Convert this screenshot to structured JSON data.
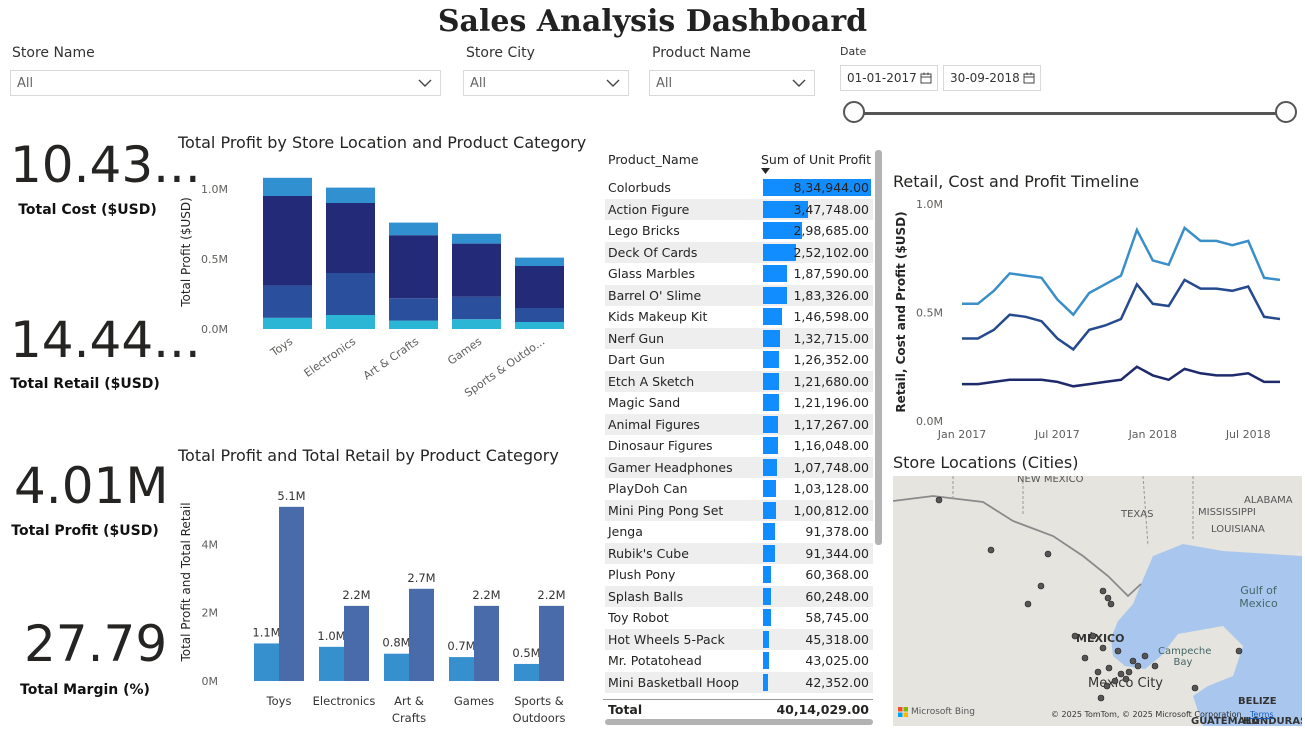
{
  "header": {
    "title": "Sales Analysis Dashboard"
  },
  "slicers": {
    "store_name": {
      "label": "Store Name",
      "value": "All"
    },
    "store_city": {
      "label": "Store City",
      "value": "All"
    },
    "product_name": {
      "label": "Product Name",
      "value": "All"
    },
    "date": {
      "label": "Date",
      "start": "01-01-2017",
      "end": "30-09-2018"
    }
  },
  "kpis": [
    {
      "value": "10.43...",
      "label": "Total Cost ($USD)"
    },
    {
      "value": "14.44...",
      "label": "Total Retail ($USD)"
    },
    {
      "value": "4.01M",
      "label": "Total Profit ($USD)"
    },
    {
      "value": "27.79",
      "label": "Total Margin (%)"
    }
  ],
  "chart_data": [
    {
      "id": "stacked",
      "type": "bar",
      "title": "Total Profit by Store Location and Product Category",
      "xlabel": "",
      "ylabel": "Total Profit ($USD)",
      "ylim": [
        0,
        1.1
      ],
      "y_ticks": [
        "0.0M",
        "0.5M",
        "1.0M"
      ],
      "categories": [
        "Toys",
        "Electronics",
        "Art & Crafts",
        "Games",
        "Sports & Outdo..."
      ],
      "series": [
        {
          "color": "#2bb6d6",
          "values": [
            0.08,
            0.1,
            0.06,
            0.07,
            0.05
          ]
        },
        {
          "color": "#2a4f9c",
          "values": [
            0.23,
            0.3,
            0.16,
            0.16,
            0.1
          ]
        },
        {
          "color": "#232a78",
          "values": [
            0.64,
            0.5,
            0.45,
            0.38,
            0.3
          ]
        },
        {
          "color": "#3190cf",
          "values": [
            0.13,
            0.11,
            0.09,
            0.07,
            0.06
          ]
        }
      ]
    },
    {
      "id": "clustered",
      "type": "bar",
      "title": "Total Profit and Total Retail by Product Category",
      "xlabel": "",
      "ylabel": "Total Profit and Total Retail",
      "ylim": [
        0,
        5.3
      ],
      "y_ticks": [
        "0M",
        "2M",
        "4M"
      ],
      "categories": [
        "Toys",
        "Electronics",
        "Art & Crafts",
        "Games",
        "Sports & Outdoors"
      ],
      "category_lines": [
        [
          "Toys"
        ],
        [
          "Electronics"
        ],
        [
          "Art &",
          "Crafts"
        ],
        [
          "Games"
        ],
        [
          "Sports &",
          "Outdoors"
        ]
      ],
      "series": [
        {
          "color": "#3590cd",
          "values": [
            1.1,
            1.0,
            0.8,
            0.7,
            0.5
          ],
          "labels": [
            "1.1M",
            "1.0M",
            "0.8M",
            "0.7M",
            "0.5M"
          ]
        },
        {
          "color": "#4a6baa",
          "values": [
            5.1,
            2.2,
            2.7,
            2.2,
            2.2
          ],
          "labels": [
            "5.1M",
            "2.2M",
            "2.7M",
            "2.2M",
            "2.2M"
          ]
        }
      ]
    },
    {
      "id": "timeline",
      "type": "line",
      "title": "Retail, Cost and Profit Timeline",
      "xlabel": "",
      "ylabel": "Retail, Cost and Profit ($USD)",
      "ylim": [
        0,
        1.0
      ],
      "y_ticks": [
        "0.0M",
        "0.5M",
        "1.0M"
      ],
      "x_ticks": [
        "Jan 2017",
        "Jul 2017",
        "Jan 2018",
        "Jul 2018"
      ],
      "x": [
        "2017-01",
        "2017-02",
        "2017-03",
        "2017-04",
        "2017-05",
        "2017-06",
        "2017-07",
        "2017-08",
        "2017-09",
        "2017-10",
        "2017-11",
        "2017-12",
        "2018-01",
        "2018-02",
        "2018-03",
        "2018-04",
        "2018-05",
        "2018-06",
        "2018-07",
        "2018-08",
        "2018-09"
      ],
      "series": [
        {
          "color": "#3b8fc9",
          "values": [
            0.54,
            0.54,
            0.6,
            0.68,
            0.67,
            0.66,
            0.56,
            0.49,
            0.59,
            0.63,
            0.67,
            0.88,
            0.74,
            0.72,
            0.89,
            0.83,
            0.83,
            0.81,
            0.83,
            0.66,
            0.65
          ]
        },
        {
          "color": "#264a8e",
          "values": [
            0.38,
            0.38,
            0.42,
            0.49,
            0.48,
            0.46,
            0.38,
            0.33,
            0.42,
            0.44,
            0.47,
            0.63,
            0.54,
            0.53,
            0.65,
            0.61,
            0.61,
            0.6,
            0.62,
            0.48,
            0.47
          ]
        },
        {
          "color": "#1e2a6b",
          "values": [
            0.17,
            0.17,
            0.18,
            0.19,
            0.19,
            0.19,
            0.18,
            0.16,
            0.17,
            0.18,
            0.19,
            0.25,
            0.21,
            0.19,
            0.24,
            0.22,
            0.21,
            0.21,
            0.22,
            0.18,
            0.18
          ]
        }
      ]
    },
    {
      "id": "product_table",
      "type": "table",
      "columns": [
        "Product_Name",
        "Sum of Unit Profit"
      ],
      "max_value": 834944,
      "rows": [
        {
          "name": "Colorbuds",
          "display": "8,34,944.00",
          "value": 834944
        },
        {
          "name": "Action Figure",
          "display": "3,47,748.00",
          "value": 347748
        },
        {
          "name": "Lego Bricks",
          "display": "2,98,685.00",
          "value": 298685
        },
        {
          "name": "Deck Of Cards",
          "display": "2,52,102.00",
          "value": 252102
        },
        {
          "name": "Glass Marbles",
          "display": "1,87,590.00",
          "value": 187590
        },
        {
          "name": "Barrel O' Slime",
          "display": "1,83,326.00",
          "value": 183326
        },
        {
          "name": "Kids Makeup Kit",
          "display": "1,46,598.00",
          "value": 146598
        },
        {
          "name": "Nerf Gun",
          "display": "1,32,715.00",
          "value": 132715
        },
        {
          "name": "Dart Gun",
          "display": "1,26,352.00",
          "value": 126352
        },
        {
          "name": "Etch A Sketch",
          "display": "1,21,680.00",
          "value": 121680
        },
        {
          "name": "Magic Sand",
          "display": "1,21,196.00",
          "value": 121196
        },
        {
          "name": "Animal Figures",
          "display": "1,17,267.00",
          "value": 117267
        },
        {
          "name": "Dinosaur Figures",
          "display": "1,16,048.00",
          "value": 116048
        },
        {
          "name": "Gamer Headphones",
          "display": "1,07,748.00",
          "value": 107748
        },
        {
          "name": "PlayDoh Can",
          "display": "1,03,128.00",
          "value": 103128
        },
        {
          "name": "Mini Ping Pong Set",
          "display": "1,00,812.00",
          "value": 100812
        },
        {
          "name": "Jenga",
          "display": "91,378.00",
          "value": 91378
        },
        {
          "name": "Rubik's Cube",
          "display": "91,344.00",
          "value": 91344
        },
        {
          "name": "Plush Pony",
          "display": "60,368.00",
          "value": 60368
        },
        {
          "name": "Splash Balls",
          "display": "60,248.00",
          "value": 60248
        },
        {
          "name": "Toy Robot",
          "display": "58,745.00",
          "value": 58745
        },
        {
          "name": "Hot Wheels 5-Pack",
          "display": "45,318.00",
          "value": 45318
        },
        {
          "name": "Mr. Potatohead",
          "display": "43,025.00",
          "value": 43025
        },
        {
          "name": "Mini Basketball Hoop",
          "display": "42,352.00",
          "value": 42352
        }
      ],
      "total_label": "Total",
      "total_value": "40,14,029.00"
    }
  ],
  "map": {
    "title": "Store Locations (Cities)",
    "labels": [
      "NEW MEXICO",
      "TEXAS",
      "ALABAMA",
      "MISSISSIPPI",
      "LOUISIANA",
      "Gulf of Mexico",
      "MÉXICO",
      "Campeche Bay",
      "Mexico City",
      "BELIZE",
      "GUATEMALA",
      "HONDURAS"
    ],
    "attribution_brand": "Microsoft Bing",
    "attribution": "© 2025 TomTom, © 2025 Microsoft Corporation",
    "terms": "Terms",
    "water_color": "#a9c7ee",
    "land_color": "#e8e6e1"
  }
}
